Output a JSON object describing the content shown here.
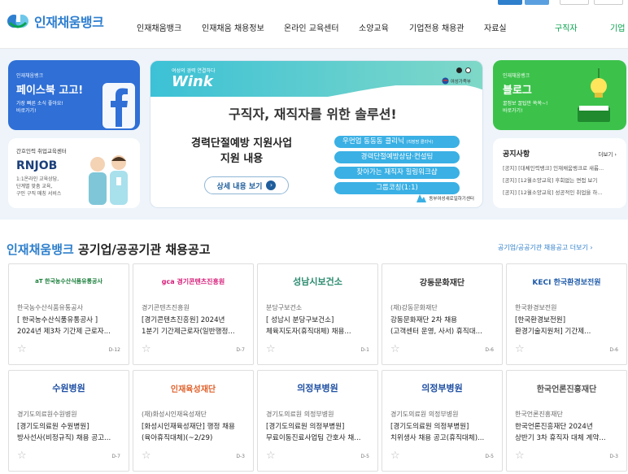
{
  "colors": {
    "brand": "#2f7fd0",
    "green": "#0aa34f",
    "facebook": "#2f6fd6",
    "blog": "#3cc24b"
  },
  "header": {
    "logo_text": "인재채움뱅크",
    "nav": [
      "인재채움뱅크",
      "인재채움 채용정보",
      "온라인 교육센터",
      "소양교육",
      "기업전용 채용관",
      "자료실",
      "구직자",
      "기업"
    ]
  },
  "banners": {
    "facebook": {
      "small": "인재채움뱅크",
      "title": "페이스북 고고!",
      "desc1": "가장 빠른 소식 좋아요!",
      "desc2": "바로가기!"
    },
    "rnjob": {
      "small": "간호인력 취업교육센터",
      "title": "RNJOB",
      "desc1": "1:1온라인 교육상담,",
      "desc2": "단계별 맞춤 교육,",
      "desc3": "구인 구직 매칭 서비스"
    },
    "wink": {
      "sub": "여성의 경력 연결하다",
      "logo": "Wink",
      "ministry": "여성가족부",
      "headline": "구직자, 재직자를 위한 솔루션!",
      "program1": "경력단절예방 지원사업",
      "program2": "지원 내용",
      "btn": "상세 내용 보기",
      "items": [
        "우먼업 동동동 클리닉",
        "경력단절예방상담·컨설팅",
        "찾아가는 재직자 힐링워크샵",
        "그룹코칭(1:1)"
      ],
      "item1_sub": "(직장맘 클리닉)",
      "org": "동부여성새로일하기센터"
    },
    "blog": {
      "small": "인재채움뱅크",
      "title": "블로그",
      "desc1": "꿀정보 꿀팁만 쏙쏙~!",
      "desc2": "바로가기!"
    },
    "notice": {
      "title": "공지사항",
      "more": "더보기 ›",
      "items": [
        "[공지] [대체인력뱅크] 인재채움뱅크로 새롭...",
        "[공지] [12월소양교육] 후회없는 면접 보기",
        "[공지] [12월소양교육] 성공적인 취업을 하..."
      ]
    }
  },
  "section": {
    "title_part1": "인재채움뱅크",
    "title_part2": " 공기업/공공기관 채용공고",
    "more": "공기업/공공기관 채용공고 더보기 ›"
  },
  "jobs": [
    {
      "logo": "aT 한국농수산식품유통공사",
      "org": "한국농수산식품유통공사",
      "t1": "[ 한국농수산식품유통공사 ]",
      "t2": "2024년 제3차 기간제 근로자...",
      "dday": "D-12"
    },
    {
      "logo": "gca 경기콘텐츠진흥원",
      "org": "경기콘텐츠진흥원",
      "t1": "[경기콘텐츠진흥원] 2024년",
      "t2": "1분기 기간제근로자(일반행정...",
      "dday": "D-7"
    },
    {
      "logo": "성남시보건소",
      "org": "분당구보건소",
      "t1": "[ 성남시 분당구보건소]",
      "t2": "체육지도자(휴직대체) 채용...",
      "dday": "D-1"
    },
    {
      "logo": "강동문화재단",
      "org": "(재)강동문화재단",
      "t1": "강동문화재단 2차 채용",
      "t2": "(고객센터 운영, 사서) 휴직대...",
      "dday": "D-6"
    },
    {
      "logo": "KECI 한국환경보전원",
      "org": "한국환경보전원",
      "t1": "[한국환경보전원]",
      "t2": "환경기술지원처] 기간제...",
      "dday": "D-6"
    },
    {
      "logo": "수원병원",
      "org": "경기도의료원수원병원",
      "t1": "[경기도의료원 수원병원]",
      "t2": "방사선사(비정규직) 채용 공고...",
      "dday": "D-7"
    },
    {
      "logo": "인재육성재단",
      "org": "(재)화성시인재육성재단",
      "t1": "[화성시인재육성재단] 행정 채용",
      "t2": "(육아휴직대체)(~2/29)",
      "dday": "D-3"
    },
    {
      "logo": "의정부병원",
      "org": "경기도의료원 의정부병원",
      "t1": "[경기도의료원 의정부병원]",
      "t2": "무료이동진료사업팀 간호사 채...",
      "dday": "D-5"
    },
    {
      "logo": "의정부병원",
      "org": "경기도의료원 의정부병원",
      "t1": "[경기도의료원 의정부병원]",
      "t2": "치위생사 채용 공고(휴직대체)...",
      "dday": "D-5"
    },
    {
      "logo": "한국언론진흥재단",
      "org": "한국언론진흥재단",
      "t1": "한국언론진흥재단 2024년",
      "t2": "상반기 3차 휴직자 대체 계약...",
      "dday": "D-3"
    }
  ]
}
